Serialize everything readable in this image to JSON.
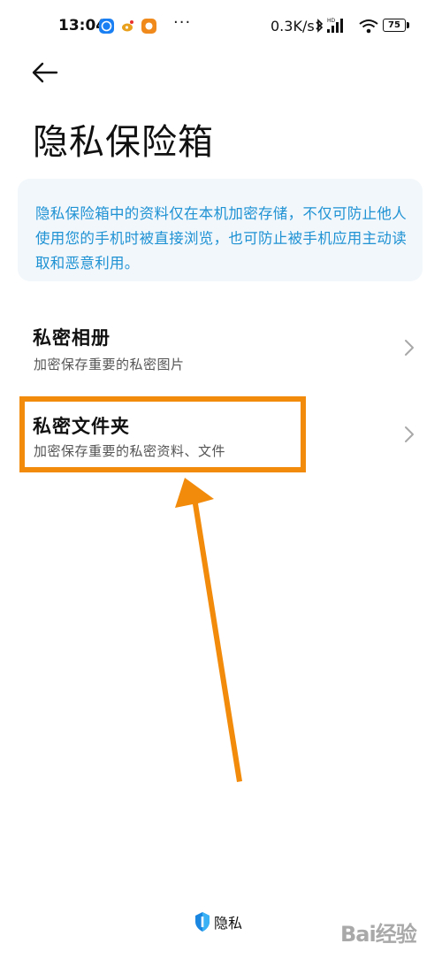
{
  "status_bar": {
    "time": "13:04",
    "dots": "···",
    "speed": "0.3K/s",
    "hd_label": "HD",
    "battery": "75"
  },
  "page": {
    "title": "隐私保险箱"
  },
  "info": {
    "text": "隐私保险箱中的资料仅在本机加密存储，不仅可防止他人使用您的手机时被直接浏览，也可防止被手机应用主动读取和恶意利用。"
  },
  "items": [
    {
      "title": "私密相册",
      "subtitle": "加密保存重要的私密图片"
    },
    {
      "title": "私密文件夹",
      "subtitle": "加密保存重要的私密资料、文件"
    }
  ],
  "footer": {
    "brand": "隐私"
  },
  "watermark": {
    "text": "Bai经验"
  },
  "colors": {
    "accent": "#1f92d4",
    "highlight": "#f28b0c",
    "card_bg": "#f2f7fb"
  }
}
